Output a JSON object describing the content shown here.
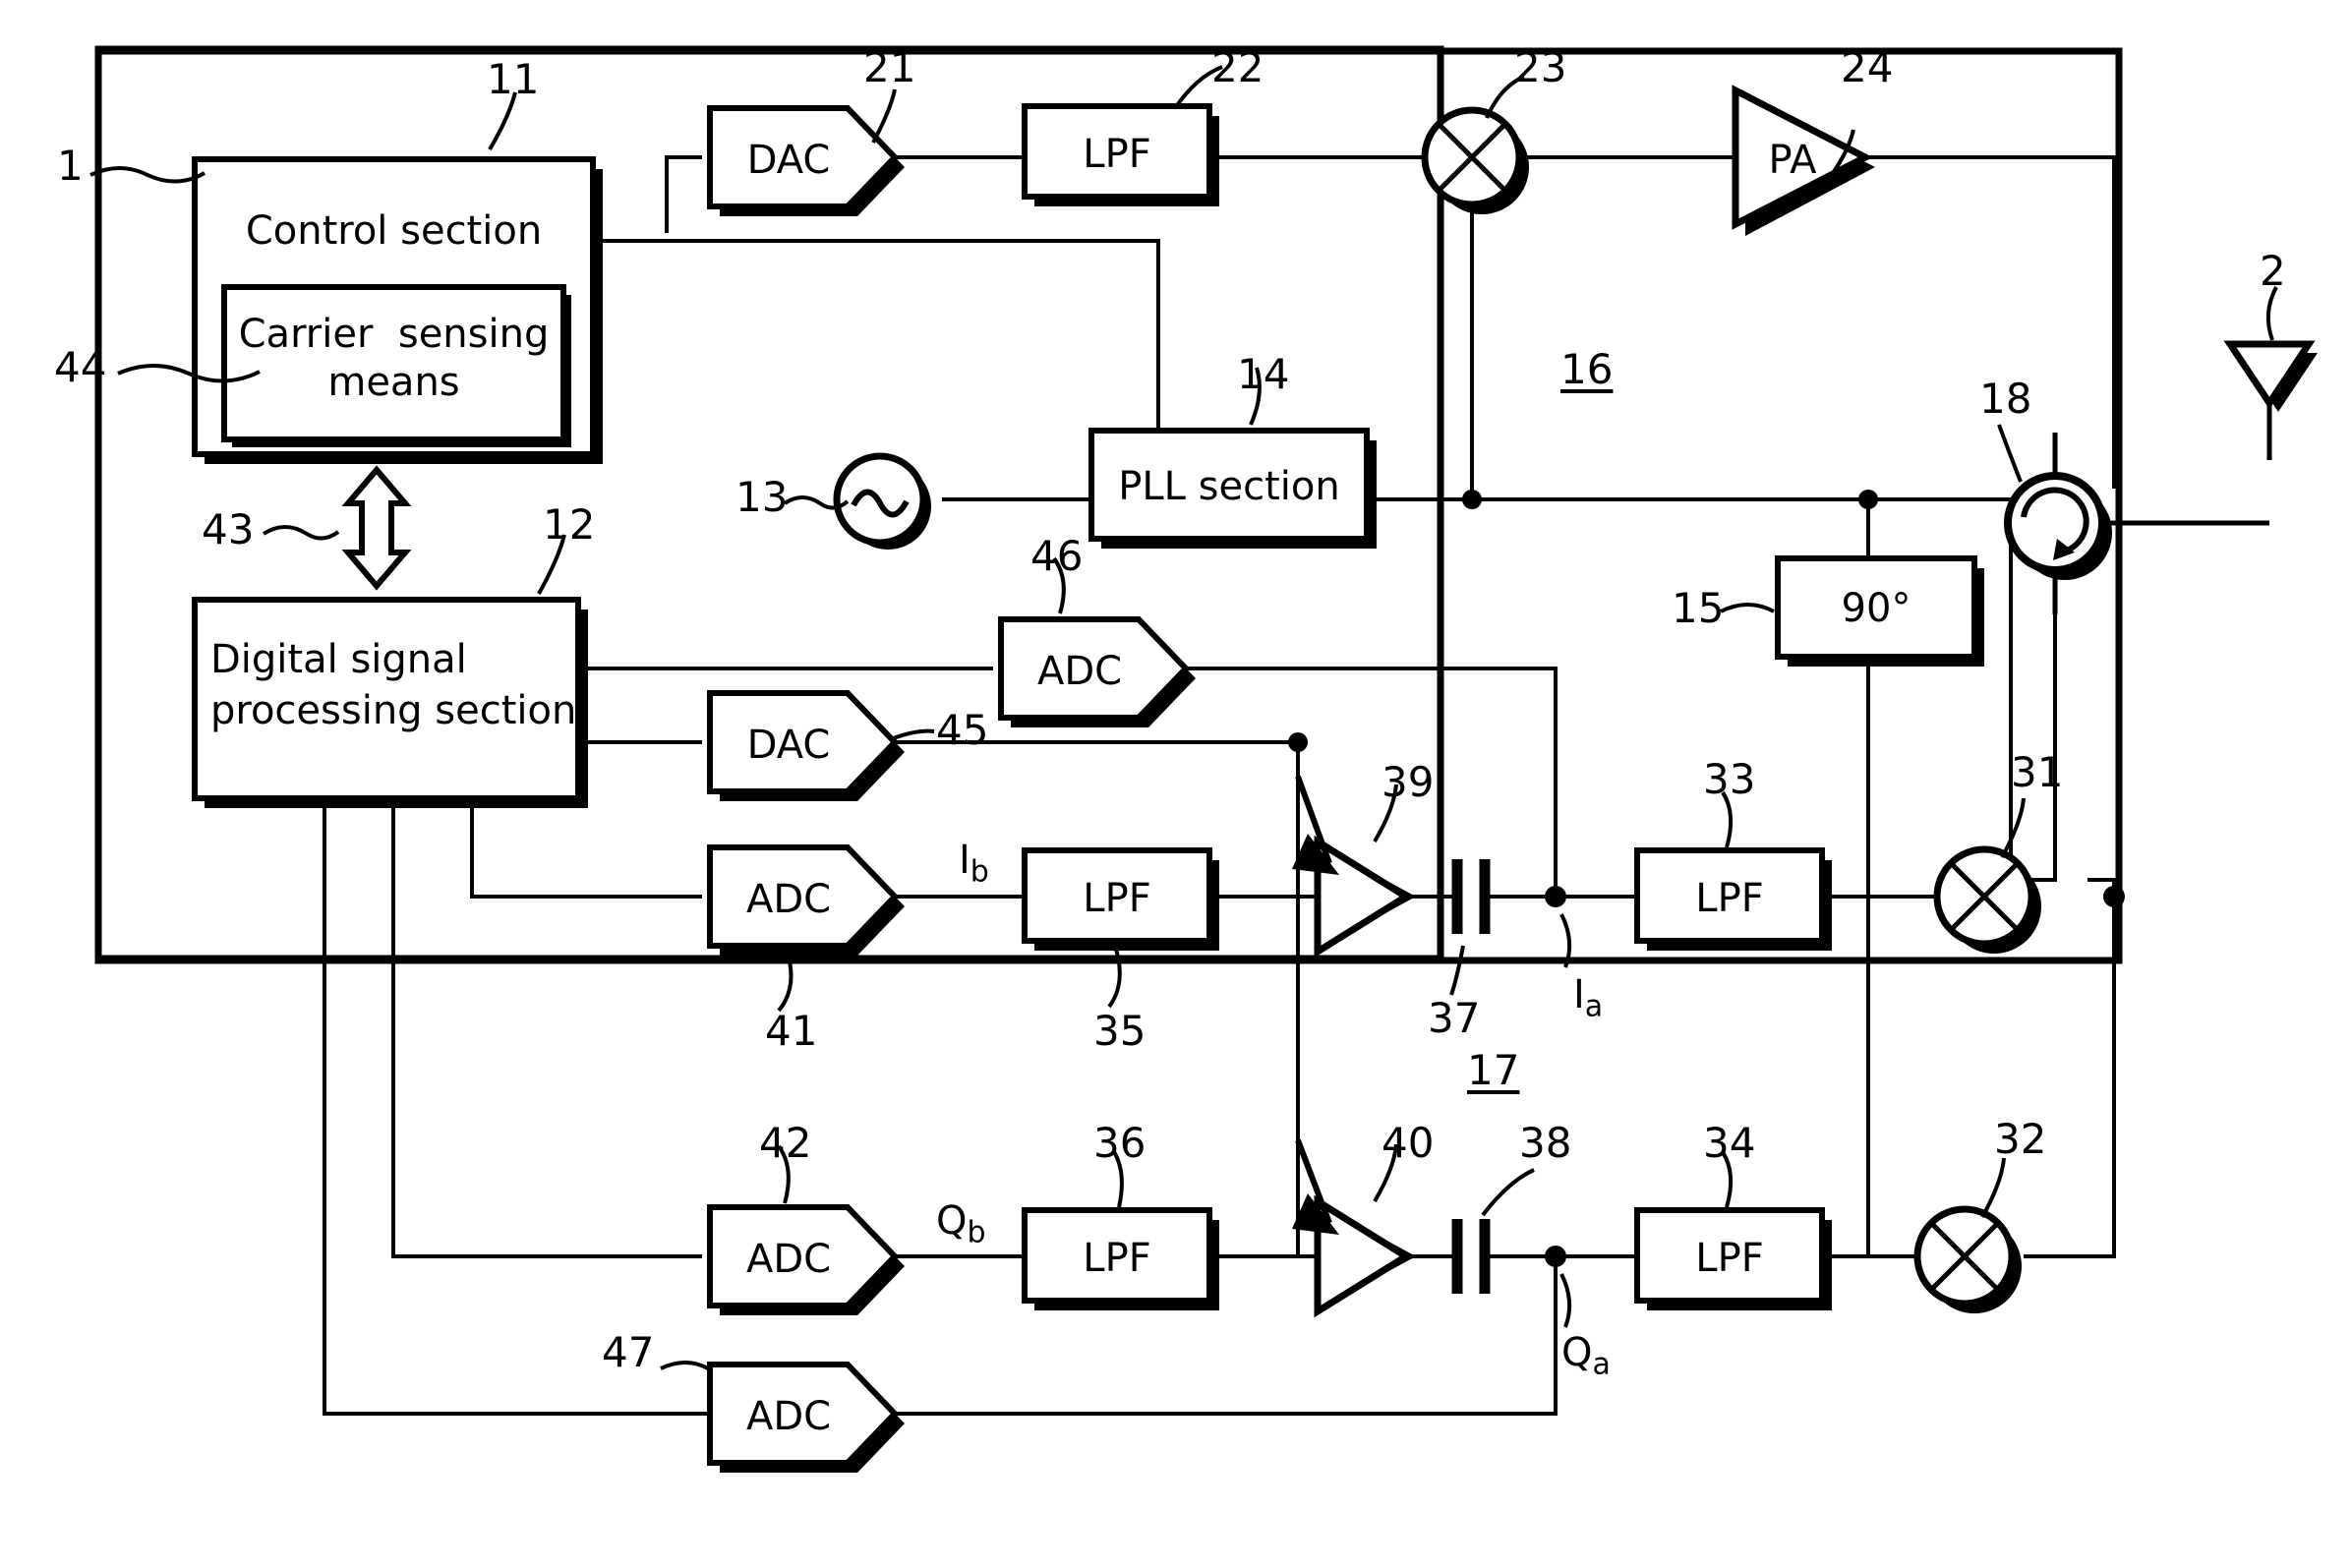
{
  "figure": {
    "type": "patent-block-diagram",
    "description": "Radio transceiver block diagram with control section, digital signal processing section, transmit chain and quadrature receive chain"
  },
  "blocks": {
    "control_section": "Control section",
    "carrier_sensing_means": "Carrier  sensing  means",
    "dsp_section_line1": "Digital signal",
    "dsp_section_line2": "processing section",
    "dac_21": "DAC",
    "lpf_22": "LPF",
    "pa_24": "PA",
    "pll_14": "PLL section",
    "phase_15": "90°",
    "adc_46": "ADC",
    "dac_45": "DAC",
    "adc_41": "ADC",
    "lpf_35": "LPF",
    "lpf_33": "LPF",
    "adc_42": "ADC",
    "lpf_36": "LPF",
    "lpf_34": "LPF",
    "adc_47": "ADC"
  },
  "signal_labels": {
    "ib": "I",
    "ib_sub": "b",
    "ia": "I",
    "ia_sub": "a",
    "qb": "Q",
    "qb_sub": "b",
    "qa": "Q",
    "qa_sub": "a"
  },
  "reference_numerals": {
    "n1": "1",
    "n2": "2",
    "n11": "11",
    "n12": "12",
    "n13": "13",
    "n14": "14",
    "n15": "15",
    "n16": "16",
    "n17": "17",
    "n18": "18",
    "n21": "21",
    "n22": "22",
    "n23": "23",
    "n24": "24",
    "n31": "31",
    "n32": "32",
    "n33": "33",
    "n34": "34",
    "n35": "35",
    "n36": "36",
    "n37": "37",
    "n38": "38",
    "n39": "39",
    "n40": "40",
    "n41": "41",
    "n42": "42",
    "n43": "43",
    "n44": "44",
    "n45": "45",
    "n46": "46",
    "n47": "47"
  },
  "symbols": {
    "antenna": "antenna-icon",
    "circulator": "circulator-icon",
    "oscillator": "oscillator-icon",
    "mixer": "mixer-icon",
    "amplifier": "amplifier-icon",
    "capacitor": "capacitor-icon",
    "bidirectional_arrow": "bidirectional-arrow-icon"
  },
  "colors": {
    "line": "#000000",
    "background": "#ffffff"
  }
}
